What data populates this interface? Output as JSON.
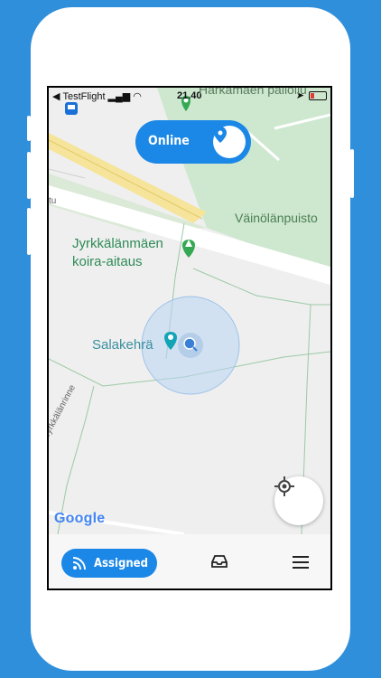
{
  "status_bar": {
    "carrier": "TestFlight",
    "time": "21.40"
  },
  "map": {
    "labels": {
      "park": "Väinölänpuisto",
      "dog_park_line1": "Jyrkkälänmäen",
      "dog_park_line2": "koira-aitaus",
      "salakehra": "Salakehrä",
      "street": "Jyrkkälänrinne",
      "top_street": "Harkämäen palloilu",
      "left_edge": "tu"
    },
    "attribution": "Google"
  },
  "status_pill": {
    "label": "Online"
  },
  "bottom_nav": {
    "assigned_label": "Assigned"
  },
  "colors": {
    "accent": "#1b87e6",
    "background": "#2f8fdb",
    "park_green": "#c8e6c9",
    "road_yellow": "#f5e79e"
  },
  "icons": [
    "back-arrow-icon",
    "signal-icon",
    "wifi-icon",
    "location-arrow-icon",
    "battery-icon",
    "map-pin-icon",
    "tree-icon",
    "palette-icon",
    "bus-icon",
    "crosshair-icon",
    "rss-icon",
    "inbox-icon",
    "menu-icon"
  ]
}
